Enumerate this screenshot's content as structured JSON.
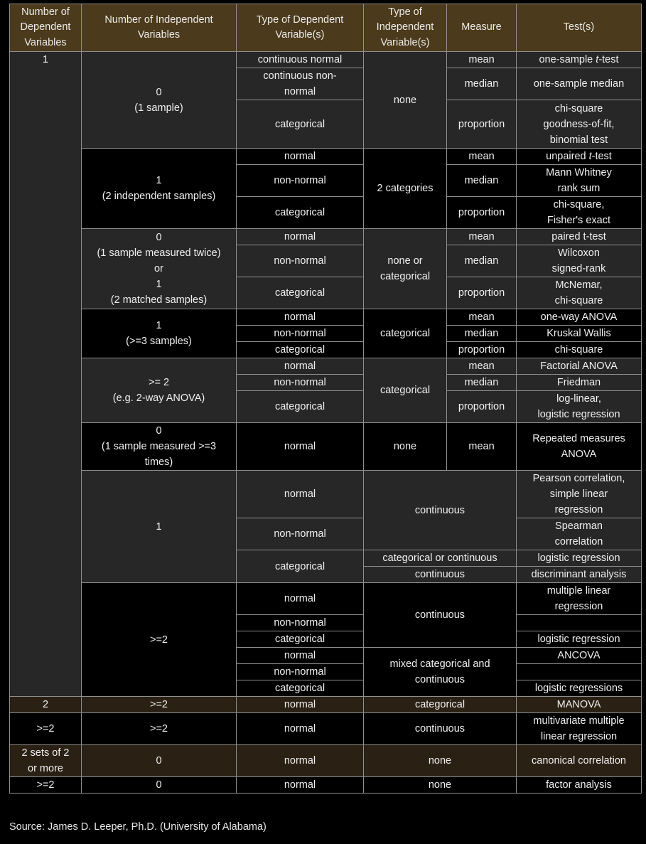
{
  "headers": {
    "num_dep": [
      "Number of",
      "Dependent",
      "Variables"
    ],
    "num_indep": [
      "Number of Independent",
      "Variables"
    ],
    "type_dep": [
      "Type of Dependent",
      "Variable(s)"
    ],
    "type_indep": [
      "Type of",
      "Independent",
      "Variable(s)"
    ],
    "measure": "Measure",
    "tests": "Test(s)"
  },
  "colors": {
    "header_bg": "#4b3a1b",
    "row_gray": "#272727",
    "row_black": "#000000",
    "row_brown": "#2a2014",
    "border": "#8f8f8f",
    "text": "#f0f0f0"
  },
  "groups": {
    "dep1": "1",
    "g1": {
      "indep": [
        "0",
        "(1 sample)"
      ],
      "indep_type": "none",
      "rows": [
        {
          "dep_type": "continuous normal",
          "measure": "mean",
          "test_pre": "one-sample ",
          "test_italic": "t",
          "test_post": "-test"
        },
        {
          "dep_type": [
            "continuous non-",
            "normal"
          ],
          "measure": "median",
          "test": "one-sample median"
        },
        {
          "dep_type": "categorical",
          "measure": "proportion",
          "test": [
            "chi-square",
            "goodness-of-fit,",
            "binomial test"
          ]
        }
      ]
    },
    "g2": {
      "indep": [
        "1",
        "(2 independent samples)"
      ],
      "indep_type": "2 categories",
      "rows": [
        {
          "dep_type": "normal",
          "measure": "mean",
          "test_pre": "unpaired ",
          "test_italic": "t",
          "test_post": "-test"
        },
        {
          "dep_type": "non-normal",
          "measure": "median",
          "test": [
            "Mann Whitney",
            "rank sum"
          ]
        },
        {
          "dep_type": "categorical",
          "measure": "proportion",
          "test": [
            "chi-square,",
            "Fisher's exact"
          ]
        }
      ]
    },
    "g3": {
      "indep": [
        "0",
        "(1 sample measured twice)",
        "or",
        "1",
        "(2 matched samples)"
      ],
      "indep_type": [
        "none or",
        "categorical"
      ],
      "rows": [
        {
          "dep_type": "normal",
          "measure": "mean",
          "test": "paired t-test"
        },
        {
          "dep_type": "non-normal",
          "measure": "median",
          "test": [
            "Wilcoxon",
            "signed-rank"
          ]
        },
        {
          "dep_type": "categorical",
          "measure": "proportion",
          "test": [
            "McNemar,",
            "chi-square"
          ]
        }
      ]
    },
    "g4": {
      "indep": [
        "1",
        "(>=3 samples)"
      ],
      "indep_type": "categorical",
      "rows": [
        {
          "dep_type": "normal",
          "measure": "mean",
          "test": "one-way ANOVA"
        },
        {
          "dep_type": "non-normal",
          "measure": "median",
          "test": "Kruskal Wallis"
        },
        {
          "dep_type": "categorical",
          "measure": "proportion",
          "test": "chi-square"
        }
      ]
    },
    "g5": {
      "indep": [
        ">= 2",
        "(e.g. 2-way ANOVA)"
      ],
      "indep_type": "categorical",
      "rows": [
        {
          "dep_type": "normal",
          "measure": "mean",
          "test": "Factorial ANOVA"
        },
        {
          "dep_type": "non-normal",
          "measure": "median",
          "test": "Friedman"
        },
        {
          "dep_type": "categorical",
          "measure": "proportion",
          "test": [
            "log-linear,",
            "logistic regression"
          ]
        }
      ]
    },
    "g6": {
      "indep": [
        "0",
        "(1 sample measured >=3",
        "times)"
      ],
      "dep_type": "normal",
      "indep_type": "none",
      "measure": "mean",
      "test": [
        "Repeated measures",
        "ANOVA"
      ]
    },
    "g7": {
      "indep": "1",
      "rows": [
        {
          "dep_type": "normal",
          "test": [
            "Pearson correlation,",
            "simple linear",
            "regression"
          ]
        },
        {
          "dep_type": "non-normal",
          "test": [
            "Spearman",
            "correlation"
          ]
        },
        {
          "dep_type": "categorical"
        }
      ],
      "indep_type_continuous": "continuous",
      "cat_rows": [
        {
          "indep_type": "categorical or continuous",
          "test": "logistic regression"
        },
        {
          "indep_type": "continuous",
          "test": "discriminant analysis"
        }
      ]
    },
    "g8": {
      "indep": ">=2",
      "block1_indep_type": "continuous",
      "block2_indep_type": [
        "mixed categorical and",
        "continuous"
      ],
      "rows": [
        {
          "dep_type": "normal",
          "test": [
            "multiple linear",
            "regression"
          ]
        },
        {
          "dep_type": "non-normal",
          "test": ""
        },
        {
          "dep_type": "categorical",
          "test": "logistic regression"
        },
        {
          "dep_type": "normal",
          "test": "ANCOVA"
        },
        {
          "dep_type": "non-normal",
          "test": ""
        },
        {
          "dep_type": "categorical",
          "test": "logistic regressions"
        }
      ]
    }
  },
  "bottom_rows": [
    {
      "dep": "2",
      "indep": ">=2",
      "dep_type": "normal",
      "indep_type": "categorical",
      "test": "MANOVA"
    },
    {
      "dep": ">=2",
      "indep": ">=2",
      "dep_type": "normal",
      "indep_type": "continuous",
      "test": [
        "multivariate multiple",
        "linear regression"
      ]
    },
    {
      "dep": [
        "2 sets of 2",
        "or more"
      ],
      "indep": "0",
      "dep_type": "normal",
      "indep_type": "none",
      "test": "canonical correlation"
    },
    {
      "dep": ">=2",
      "indep": "0",
      "dep_type": "normal",
      "indep_type": "none",
      "test": "factor analysis"
    }
  ],
  "source": "Source: James D. Leeper, Ph.D. (University of Alabama)"
}
